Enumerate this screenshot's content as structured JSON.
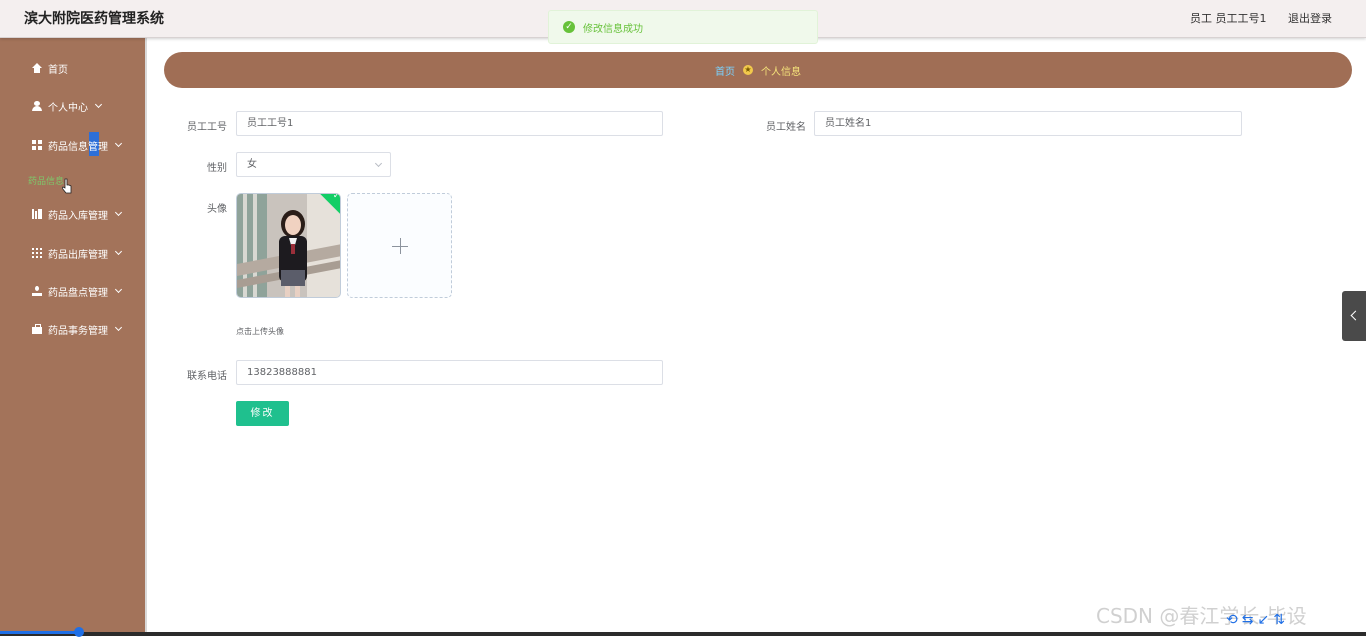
{
  "app": {
    "title": "滨大附院医药管理系统",
    "user_info": "员工 员工工号1",
    "logout_label": "退出登录"
  },
  "toast": {
    "message": "修改信息成功",
    "icon": "check-circle-icon",
    "color": "#67c23a"
  },
  "sidebar": {
    "background": "#a3735a",
    "items": [
      {
        "label": "首页",
        "icon": "home-icon",
        "has_children": false
      },
      {
        "label": "个人中心",
        "icon": "user-icon",
        "has_children": true
      },
      {
        "label": "药品信息管理",
        "icon": "grid-icon",
        "has_children": true
      },
      {
        "label": "药品入库管理",
        "icon": "books-icon",
        "has_children": true
      },
      {
        "label": "药品出库管理",
        "icon": "grid9-icon",
        "has_children": true
      },
      {
        "label": "药品盘点管理",
        "icon": "person-icon",
        "has_children": true
      },
      {
        "label": "药品事务管理",
        "icon": "briefcase-icon",
        "has_children": true
      }
    ],
    "sub_item": "药品信息"
  },
  "breadcrumb": {
    "home": "首页",
    "current": "个人信息",
    "background": "#a06e55"
  },
  "form": {
    "employee_id_label": "员工工号",
    "employee_id_value": "员工工号1",
    "employee_name_label": "员工姓名",
    "employee_name_value": "员工姓名1",
    "gender_label": "性别",
    "gender_value": "女",
    "avatar_label": "头像",
    "avatar_hint": "点击上传头像",
    "phone_label": "联系电话",
    "phone_value": "13823888881",
    "submit_label": "修改",
    "submit_color": "#1fc08e"
  },
  "watermark": "CSDN @春江学长-毕设"
}
